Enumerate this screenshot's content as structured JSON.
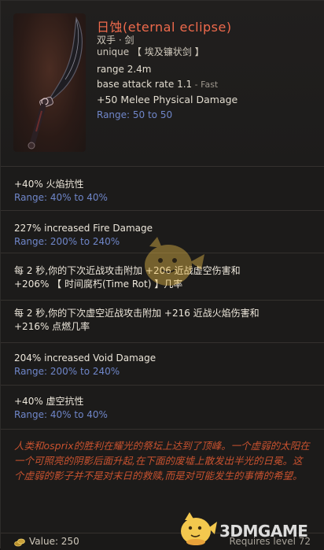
{
  "item": {
    "name": "日蚀(eternal eclipse)",
    "subtype": "双手 · 剑",
    "rarity": "unique",
    "base_type": "【 埃及镰状剑 】",
    "icon": "khopesh-sword-icon"
  },
  "stats": {
    "range": "range 2.4m",
    "attack_rate_label": "base attack rate 1.1",
    "attack_rate_speed": " - Fast",
    "implicit": "+50 Melee Physical Damage",
    "implicit_range": "Range: 50 to 50"
  },
  "affixes": [
    {
      "line1": "+40% 火焰抗性",
      "line2": "Range: 40% to 40%"
    },
    {
      "line1": "227% increased Fire Damage",
      "line2": "Range: 200% to 240%"
    },
    {
      "line1": "每 2 秒,你的下次近战攻击附加 +206 近战虚空伤害和",
      "line2": "+206% 【 时间腐朽(Time Rot) 】几率"
    },
    {
      "line1": "每 2 秒,你的下次虚空近战攻击附加 +216 近战火焰伤害和",
      "line2": "+216% 点燃几率"
    },
    {
      "line1": "204% increased Void Damage",
      "line2": "Range: 200% to 240%"
    },
    {
      "line1": "+40% 虚空抗性",
      "line2": "Range: 40% to 40%"
    }
  ],
  "lore": "人类和osprix的胜利在耀光的祭坛上达到了顶峰。一个虚弱的太阳在一个可照亮的阴影后面升起,在下面的废墟上散发出半光的日冕。这个虚弱的影子并不是对末日的救赎,而是对可能发生的事情的希望。",
  "footer": {
    "value": "Value: 250",
    "requires": "Requires level 72"
  },
  "watermark": {
    "text": "3DMGAME"
  },
  "colors": {
    "unique_title": "#ef6a4c",
    "range_blue": "#6f86c9",
    "lore_red": "#c9522f"
  }
}
